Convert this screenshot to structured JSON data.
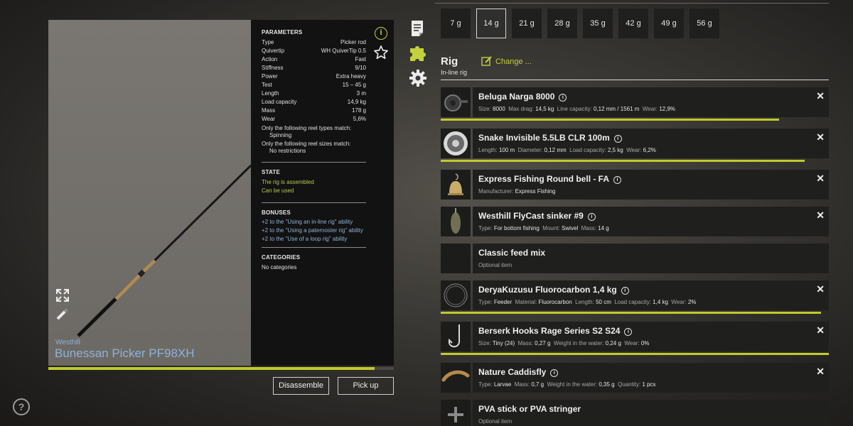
{
  "rod": {
    "brand": "Westhill",
    "name": "Bunessan Picker PF98XH",
    "condition_fraction": 0.945,
    "params_title": "PARAMETERS",
    "params": [
      {
        "label": "Type",
        "value": "Picker rod"
      },
      {
        "label": "Quivertip",
        "value": "WH QuiverTip 0.5"
      },
      {
        "label": "Action",
        "value": "Fast"
      },
      {
        "label": "Stiffness",
        "value": "9/10"
      },
      {
        "label": "Power",
        "value": "Extra heavy"
      },
      {
        "label": "Test",
        "value": "15 – 45 g"
      },
      {
        "label": "Length",
        "value": "3 m"
      },
      {
        "label": "Load capacity",
        "value": "14,9 kg"
      },
      {
        "label": "Mass",
        "value": "178 g"
      },
      {
        "label": "Wear",
        "value": "5,6%"
      }
    ],
    "reel_types_label": "Only the following reel types match:",
    "reel_types_value": "Spinning",
    "reel_sizes_label": "Only the following reel sizes match:",
    "reel_sizes_value": "No restrictions",
    "state_title": "STATE",
    "state": [
      "The rig is assembled",
      "Can be used"
    ],
    "bonuses_title": "BONUSES",
    "bonuses": [
      "+2 to the \"Using an in-line rig\" ability",
      "+2 to the \"Using a paternoster rig\" ability",
      "+2 to the \"Use of a loop rig\" ability"
    ],
    "categories_title": "CATEGORIES",
    "categories_value": "No categories"
  },
  "buttons": {
    "disassemble": "Disassemble",
    "pickup": "Pick up"
  },
  "icons": {
    "info": "i",
    "help": "?",
    "item_info": "i",
    "close": "✕",
    "accent": "#c3d23c",
    "link_blue": "#8fb1d9"
  },
  "weights": {
    "options": [
      "7 g",
      "14 g",
      "21 g",
      "28 g",
      "35 g",
      "42 g",
      "49 g",
      "56 g"
    ],
    "selected_index": 1
  },
  "rig": {
    "title": "Rig",
    "subtitle": "In-line rig",
    "change_label": "Change ...",
    "items": [
      {
        "name": "Beluga Narga 8000",
        "has_info": true,
        "closable": true,
        "wear_fraction": 0.871,
        "details": [
          [
            "Size:",
            "8000"
          ],
          [
            "Max drag:",
            "14,5 kg"
          ],
          [
            "Line capacity:",
            "0,12 mm / 1561 m"
          ],
          [
            "Wear:",
            "12,9%"
          ]
        ]
      },
      {
        "name": "Snake Invisible 5.5LB CLR 100m",
        "has_info": true,
        "closable": true,
        "wear_fraction": 0.938,
        "details": [
          [
            "Length:",
            "100 m"
          ],
          [
            "Diameter:",
            "0,12 mm"
          ],
          [
            "Load capacity:",
            "2,5 kg"
          ],
          [
            "Wear:",
            "6,2%"
          ]
        ]
      },
      {
        "name": "Express Fishing Round bell - FA",
        "has_info": true,
        "closable": true,
        "wear_fraction": null,
        "details": [
          [
            "Manufacturer:",
            "Express Fishing"
          ]
        ]
      },
      {
        "name": "Westhill FlyCast sinker #9",
        "has_info": true,
        "closable": true,
        "wear_fraction": null,
        "details": [
          [
            "Type:",
            "For bottom fishing"
          ],
          [
            "Mount:",
            "Swivel"
          ],
          [
            "Mass:",
            "14 g"
          ]
        ]
      },
      {
        "name": "Classic feed mix",
        "has_info": false,
        "closable": false,
        "wear_fraction": null,
        "details": [
          [
            "Optional item",
            ""
          ]
        ]
      },
      {
        "name": "DeryaKuzusu Fluorocarbon 1,4 kg",
        "has_info": true,
        "closable": true,
        "wear_fraction": 0.98,
        "details": [
          [
            "Type:",
            "Feeder"
          ],
          [
            "Material:",
            "Fluorocarbon"
          ],
          [
            "Length:",
            "50 cm"
          ],
          [
            "Load capacity:",
            "1,4 kg"
          ],
          [
            "Wear:",
            "2%"
          ]
        ]
      },
      {
        "name": "Berserk Hooks Rage Series S2 S24",
        "has_info": true,
        "closable": true,
        "wear_fraction": 1.0,
        "details": [
          [
            "Size:",
            "Tiny (24)"
          ],
          [
            "Mass:",
            "0,27 g"
          ],
          [
            "Weight in the water:",
            "0,24 g"
          ],
          [
            "Wear:",
            "0%"
          ]
        ]
      },
      {
        "name": "Nature Caddisfly",
        "has_info": true,
        "closable": true,
        "wear_fraction": null,
        "details": [
          [
            "Type:",
            "Larvae"
          ],
          [
            "Mass:",
            "0,7 g"
          ],
          [
            "Weight in the water:",
            "0,35 g"
          ],
          [
            "Quantity:",
            "1 pcs"
          ]
        ]
      },
      {
        "name": "PVA stick or PVA stringer",
        "has_info": false,
        "closable": false,
        "wear_fraction": null,
        "details": [
          [
            "Optional item",
            ""
          ]
        ]
      }
    ]
  }
}
